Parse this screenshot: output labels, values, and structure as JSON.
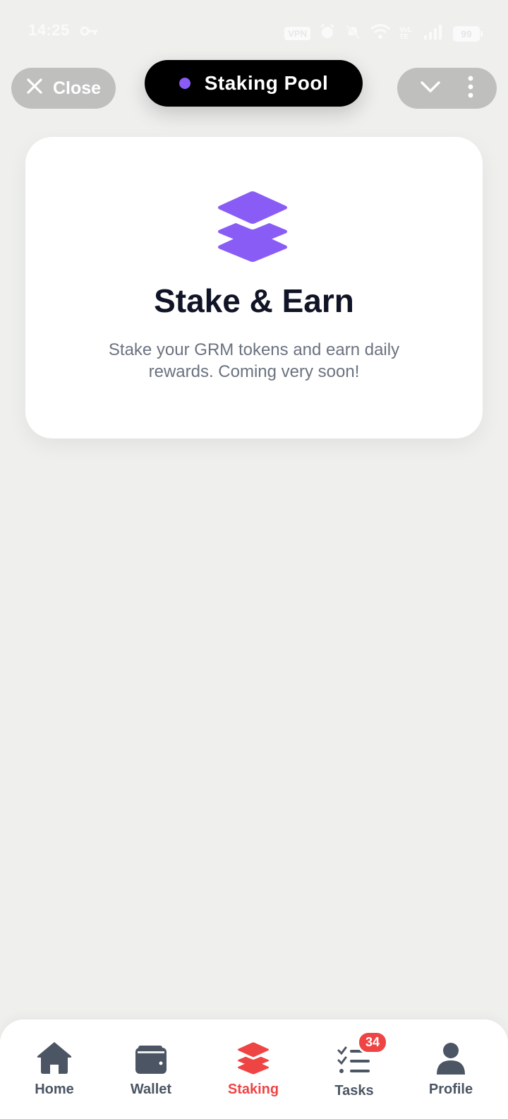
{
  "status_bar": {
    "time": "14:25",
    "vpn": "VPN",
    "network": "VoLTE",
    "battery": "99",
    "icons": [
      "key-icon",
      "alarm-icon",
      "mute-icon",
      "wifi-icon",
      "signal-icon",
      "battery-icon"
    ]
  },
  "header": {
    "close_label": "Close",
    "title": "Staking Pool",
    "dot_color": "#8a5cf6"
  },
  "hero": {
    "icon": "layers-icon",
    "title": "Stake & Earn",
    "description": "Stake your GRM tokens and earn daily rewards. Coming very soon!",
    "accent_color": "#8a5cf6"
  },
  "nav": {
    "items": [
      {
        "label": "Home",
        "icon": "home-icon"
      },
      {
        "label": "Wallet",
        "icon": "wallet-icon"
      },
      {
        "label": "Staking",
        "icon": "layers-icon",
        "active": true
      },
      {
        "label": "Tasks",
        "icon": "tasks-icon",
        "badge": "34"
      },
      {
        "label": "Profile",
        "icon": "profile-icon"
      }
    ],
    "active_color": "#ef4444",
    "inactive_color": "#4b5563"
  }
}
